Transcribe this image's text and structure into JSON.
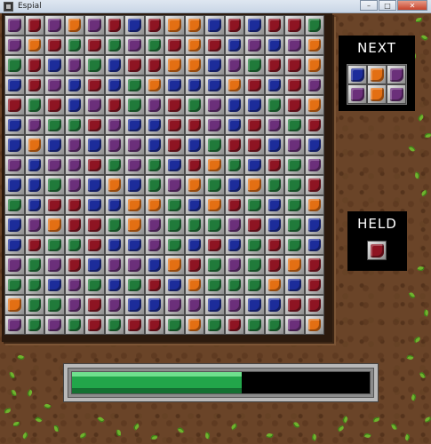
{
  "window": {
    "title": "Espial",
    "minimize_label": "–",
    "maximize_label": "□",
    "close_label": "✕"
  },
  "board": {
    "columns": 16,
    "rows": 16,
    "gem_colors": {
      "r": "#8e1422",
      "g": "#207a3a",
      "b": "#1c2c9a",
      "o": "#e36f13",
      "p": "#6b2f7a"
    },
    "cells": [
      "prpoprbroobrbrrg",
      "porgrgpgrorbpbpo",
      "grbpgbrroobpgrro",
      "brpbrbgobbborbrp",
      "rgrbprgprgpbbgro",
      "bpggrpbbrrpbrpgr",
      "bobpbppbrbgrrbpb",
      "pbpprgpgbrogbrgp",
      "bbgpbobgpogboggr",
      "gbrrbboogborgbgo",
      "bporrgopgggprbgb",
      "brggrbbpgbrbgrgb",
      "pgprbppborgpgror",
      "ggbpgbgrbogggobr",
      "oggprpbbppbpbbrr",
      "pgpgrgrrgogrggpo"
    ]
  },
  "next_panel": {
    "label": "NEXT",
    "cells": [
      "b",
      "o",
      "p",
      "p",
      "o",
      "p"
    ]
  },
  "held_panel": {
    "label": "HELD",
    "cell": "r"
  },
  "progress": {
    "value": 0.57
  }
}
